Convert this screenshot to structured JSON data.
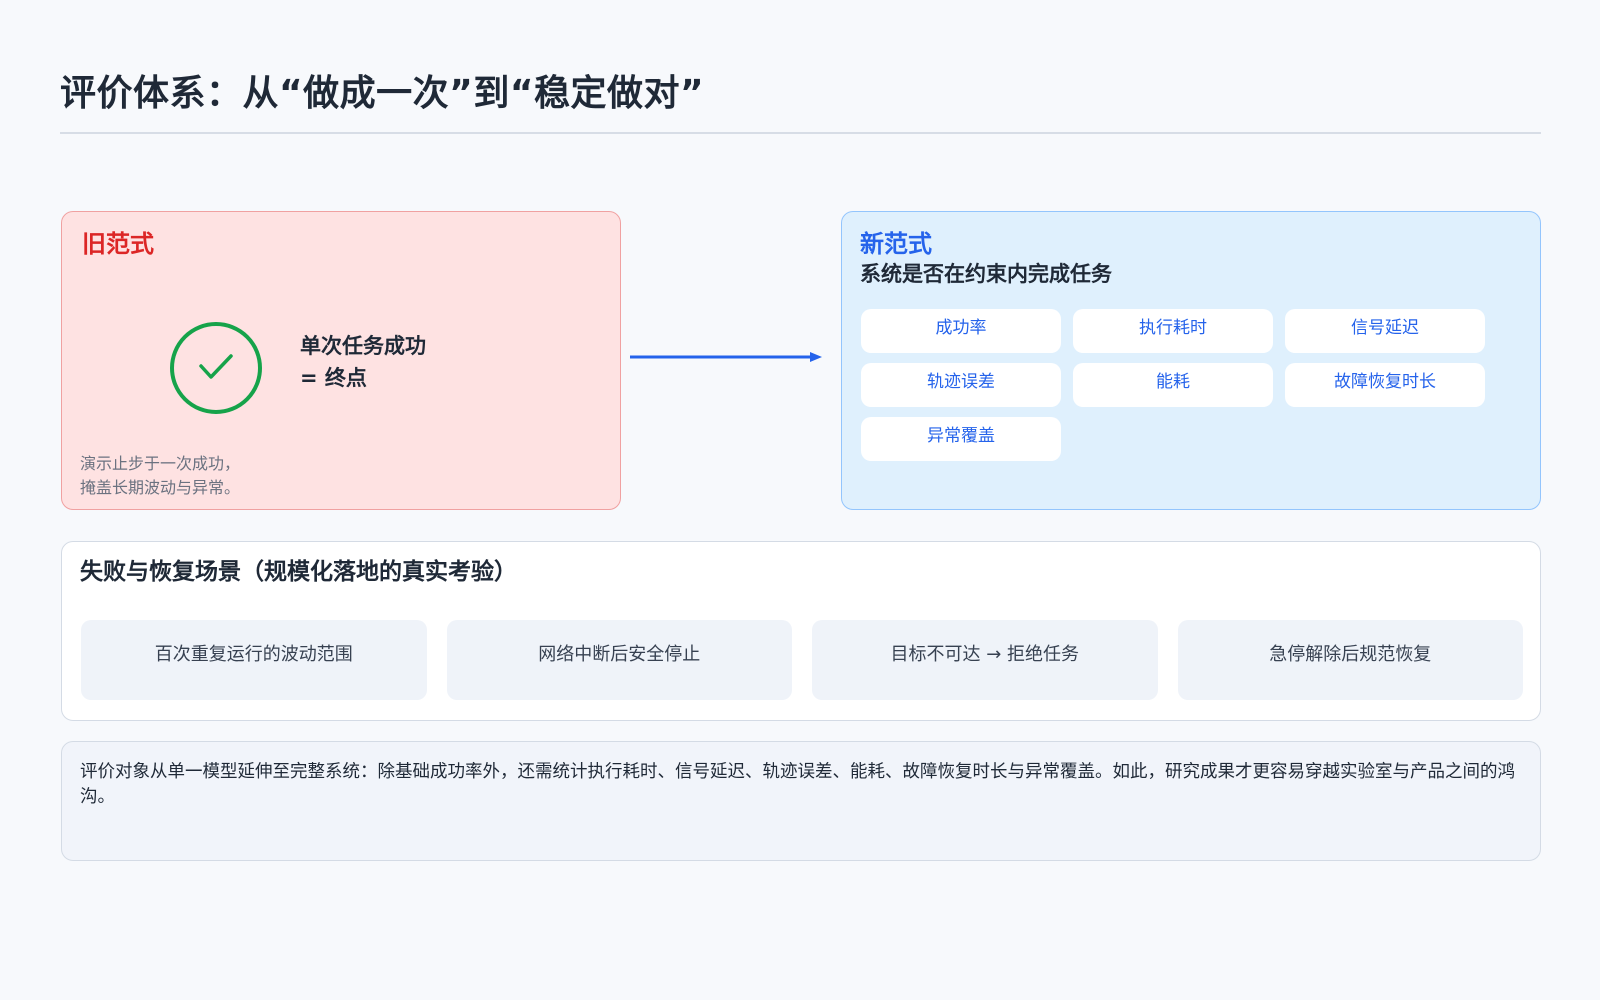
{
  "title": "评价体系：从“做成一次”到“稳定做对”",
  "old_paradigm": {
    "heading": "旧范式",
    "statement_line1": "单次任务成功",
    "statement_line2": "= 终点",
    "note_line1": "演示止步于一次成功，",
    "note_line2": "掩盖长期波动与异常。",
    "icon": "check-circle-icon",
    "colors": {
      "background": "#fee2e2",
      "accent": "#dc2626",
      "check": "#16a34a"
    }
  },
  "arrow": {
    "icon": "arrow-right-icon",
    "color": "#2563eb"
  },
  "new_paradigm": {
    "heading": "新范式",
    "subtitle": "系统是否在约束内完成任务",
    "metrics": [
      "成功率",
      "执行耗时",
      "信号延迟",
      "轨迹误差",
      "能耗",
      "故障恢复时长",
      "异常覆盖"
    ],
    "colors": {
      "background": "#dff0fd",
      "accent": "#2563eb"
    }
  },
  "failure_section": {
    "heading": "失败与恢复场景（规模化落地的真实考验）",
    "scenarios": [
      "百次重复运行的波动范围",
      "网络中断后安全停止",
      "目标不可达 → 拒绝任务",
      "急停解除后规范恢复"
    ]
  },
  "summary": "评价对象从单一模型延伸至完整系统：除基础成功率外，还需统计执行耗时、信号延迟、轨迹误差、能耗、故障恢复时长与异常覆盖。如此，研究成果才更容易穿越实验室与产品之间的鸿沟。"
}
